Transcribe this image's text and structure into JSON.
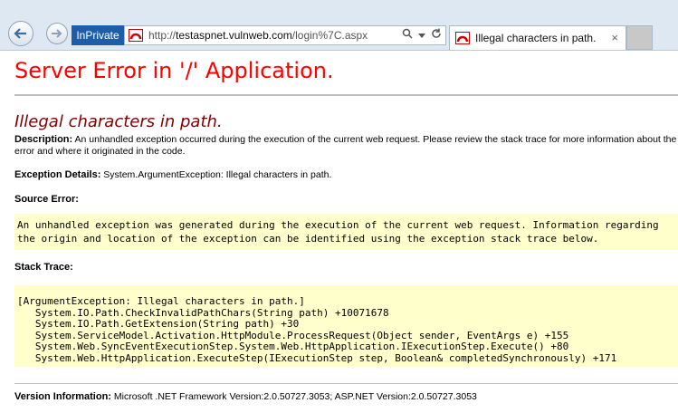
{
  "browser": {
    "inprivate_label": "InPrivate",
    "address": {
      "scheme": "http://",
      "host": "testaspnet.vulnweb.com",
      "path": "/login%7C.aspx"
    },
    "tab": {
      "title": "Illegal characters in path.",
      "close_label": "×"
    },
    "icons": {
      "back": "back-arrow-icon",
      "forward": "forward-arrow-icon",
      "favicon": "site-favicon-icon",
      "search": "search-icon",
      "dropdown": "chevron-down-icon",
      "refresh": "refresh-icon"
    }
  },
  "page": {
    "heading": "Server Error in '/' Application.",
    "error_title": "Illegal characters in path.",
    "description": {
      "label": "Description:",
      "text": "An unhandled exception occurred during the execution of the current web request. Please review the stack trace for more information about the error and where it originated in the code."
    },
    "exception_details": {
      "label": "Exception Details:",
      "text": "System.ArgumentException: Illegal characters in path."
    },
    "source_error": {
      "label": "Source Error:",
      "lines": [
        "An unhandled exception was generated during the execution of the current web request. Information regarding",
        "the origin and location of the exception can be identified using the exception stack trace below."
      ]
    },
    "stack_trace": {
      "label": "Stack Trace:",
      "lines": [
        "[ArgumentException: Illegal characters in path.]",
        "   System.IO.Path.CheckInvalidPathChars(String path) +10071678",
        "   System.IO.Path.GetExtension(String path) +30",
        "   System.ServiceModel.Activation.HttpModule.ProcessRequest(Object sender, EventArgs e) +155",
        "   System.Web.SyncEventExecutionStep.System.Web.HttpApplication.IExecutionStep.Execute() +80",
        "   System.Web.HttpApplication.ExecuteStep(IExecutionStep step, Boolean& completedSynchronously) +171"
      ]
    },
    "version": {
      "label": "Version Information:",
      "text": "Microsoft .NET Framework Version:2.0.50727.3053; ASP.NET Version:2.0.50727.3053"
    }
  },
  "colors": {
    "heading": "#ff0000",
    "error_title": "#800000",
    "code_background": "#ffffcc",
    "inprivate_badge": "#1e5ea9"
  }
}
